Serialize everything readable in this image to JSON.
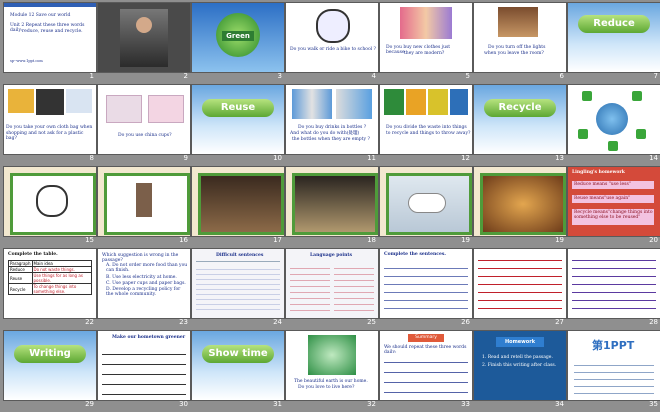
{
  "slides": [
    {
      "num": "1",
      "lines": [
        "Module 12  Save our world",
        "Unit 2 Repeat these three words daily:",
        "reduce, reuse and recycle.",
        "sp--www.1ppt.com"
      ]
    },
    {
      "num": "2",
      "lines": []
    },
    {
      "num": "3",
      "lines": [
        "Green"
      ]
    },
    {
      "num": "4",
      "lines": [
        "Do you walk or ride a bike to school ?"
      ]
    },
    {
      "num": "5",
      "lines": [
        "Do you buy new clothes just because",
        "they are modern?"
      ]
    },
    {
      "num": "6",
      "lines": [
        "Do you turn off the lights",
        "when you leave the room?"
      ]
    },
    {
      "num": "7",
      "lines": [
        "Reduce"
      ]
    },
    {
      "num": "8",
      "lines": [
        "Do you take your own cloth bag when",
        "shopping and not ask for a plastic bag?"
      ]
    },
    {
      "num": "9",
      "lines": [
        "Do you use china cups?"
      ]
    },
    {
      "num": "10",
      "lines": [
        "Reuse"
      ]
    },
    {
      "num": "11",
      "lines": [
        "Do you buy drinks in bottles ?",
        "And what do you do with(处理)",
        "the bottles when they are empty ?"
      ]
    },
    {
      "num": "12",
      "lines": [
        "Do you divide the waste into things",
        "to recycle and things to throw away?"
      ]
    },
    {
      "num": "13",
      "lines": [
        "Recycle"
      ]
    },
    {
      "num": "14",
      "lines": []
    },
    {
      "num": "15",
      "lines": []
    },
    {
      "num": "16",
      "lines": []
    },
    {
      "num": "17",
      "lines": []
    },
    {
      "num": "18",
      "lines": []
    },
    {
      "num": "19",
      "lines": []
    },
    {
      "num": "20",
      "lines": [
        "Lingling's homework",
        "Reduce means \"use less\"",
        "Reuse means\"use again\"",
        "Recycle means\"change things into something else to be reused\""
      ]
    },
    {
      "num": "22",
      "lines": [
        "Complete the table.",
        "Paragraph",
        "Main idea",
        "Reduce",
        "Do not waste things.",
        "Reuse",
        "Use things for as long as possible.",
        "Recycle",
        "To change things into something else."
      ]
    },
    {
      "num": "23",
      "lines": [
        "Which suggestion is wrong in the passage?",
        "A. Do not order more food than you can finish.",
        "B. Use less electricity at home.",
        "C. Use paper cups and paper bags.",
        "D. Develop a recycling policy for the whole community."
      ]
    },
    {
      "num": "24",
      "lines": [
        "Difficult sentences"
      ]
    },
    {
      "num": "25",
      "lines": [
        "Language points"
      ]
    },
    {
      "num": "26",
      "lines": [
        "Complete the sentences."
      ]
    },
    {
      "num": "27",
      "lines": []
    },
    {
      "num": "28",
      "lines": []
    },
    {
      "num": "29",
      "lines": [
        "Writing"
      ]
    },
    {
      "num": "30",
      "lines": [
        "Make our hometown greener"
      ]
    },
    {
      "num": "31",
      "lines": [
        "Show time"
      ]
    },
    {
      "num": "32",
      "lines": [
        "The beautiful earth is our home.",
        "Do you love to live here?"
      ]
    },
    {
      "num": "33",
      "lines": [
        "Summary",
        "We should repeat these three words daily:"
      ]
    },
    {
      "num": "34",
      "lines": [
        "Homework",
        "1. Read and retell the passage.",
        "2. Finish this writing after class."
      ]
    },
    {
      "num": "35",
      "lines": [
        "第1PPT"
      ]
    }
  ],
  "colors": {
    "background": "#8f8f8f",
    "green_banner": "#5da733",
    "title_blue": "#1a2f8a",
    "accent_red": "#c0202b"
  }
}
